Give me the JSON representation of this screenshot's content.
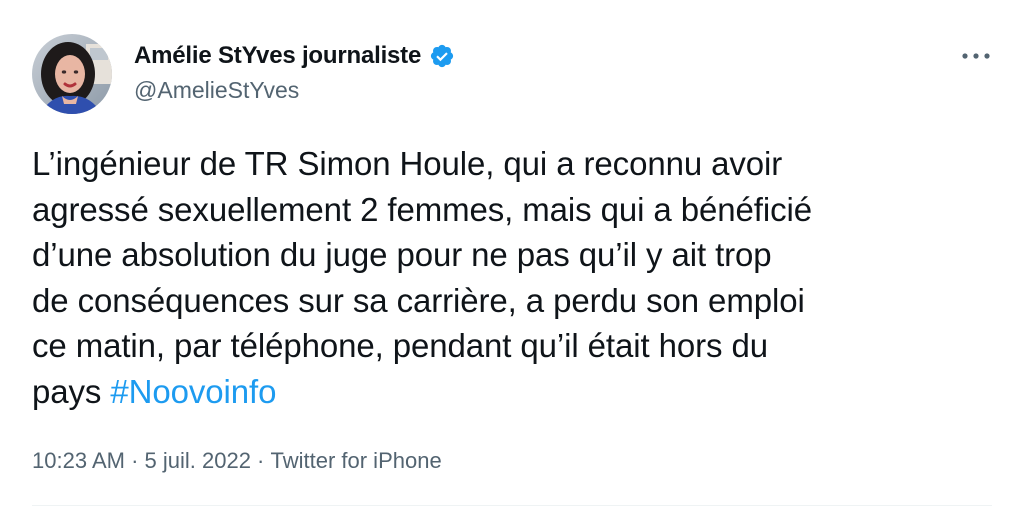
{
  "author": {
    "display_name": "Amélie StYves journaliste",
    "handle": "@AmelieStYves",
    "verified": true,
    "verified_color": "#1d9bf0",
    "avatar_icon": "profile-photo"
  },
  "tweet": {
    "lines": [
      "L’ingénieur de TR Simon Houle, qui a reconnu  avoir",
      "agressé sexuellement 2 femmes, mais qui a bénéficié",
      "d’une absolution du juge pour ne pas qu’il y ait trop",
      "de conséquences sur sa carrière, a perdu son emploi",
      "ce matin, par téléphone, pendant qu’il était hors du"
    ],
    "last_line_prefix": "pays ",
    "hashtag": "#Noovoinfo",
    "hashtag_color": "#1d9bf0"
  },
  "meta": {
    "time": "10:23 AM",
    "separator": " · ",
    "date": "5 juil. 2022",
    "source": "Twitter for iPhone"
  },
  "menu": {
    "icon": "more-horizontal-icon"
  }
}
